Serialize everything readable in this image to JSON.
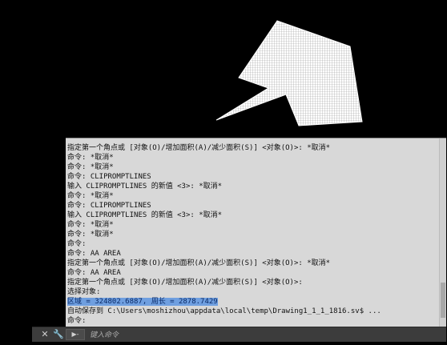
{
  "history": {
    "lines": [
      "指定第一个角点或 [对象(O)/增加面积(A)/减少面积(S)] <对象(O)>: *取消*",
      "命令: *取消*",
      "命令: *取消*",
      "命令: CLIPROMPTLINES",
      "输入 CLIPROMPTLINES 的新值 <3>: *取消*",
      "命令: *取消*",
      "命令: CLIPROMPTLINES",
      "输入 CLIPROMPTLINES 的新值 <3>: *取消*",
      "命令: *取消*",
      "命令: *取消*",
      "命令:",
      "命令: AA AREA",
      "指定第一个角点或 [对象(O)/增加面积(A)/减少面积(S)] <对象(O)>: *取消*",
      "命令: AA AREA",
      "指定第一个角点或 [对象(O)/增加面积(A)/减少面积(S)] <对象(O)>:",
      "选择对象:",
      "区域 = 324802.6887, 周长 = 2878.7429",
      "自动保存到 C:\\Users\\moshizhou\\appdata\\local\\temp\\Drawing1_1_1_1816.sv$ ...",
      "命令:"
    ]
  },
  "cmdbar": {
    "close_icon": "close-icon",
    "settings_icon": "wrench-icon",
    "prompt_toggle": "▶-",
    "input_placeholder": "键入命令"
  },
  "colors": {
    "canvas_bg": "#000000",
    "history_bg": "#d8d8d8",
    "highlight": "#6f9fe0",
    "hatch": "#ffffff"
  }
}
